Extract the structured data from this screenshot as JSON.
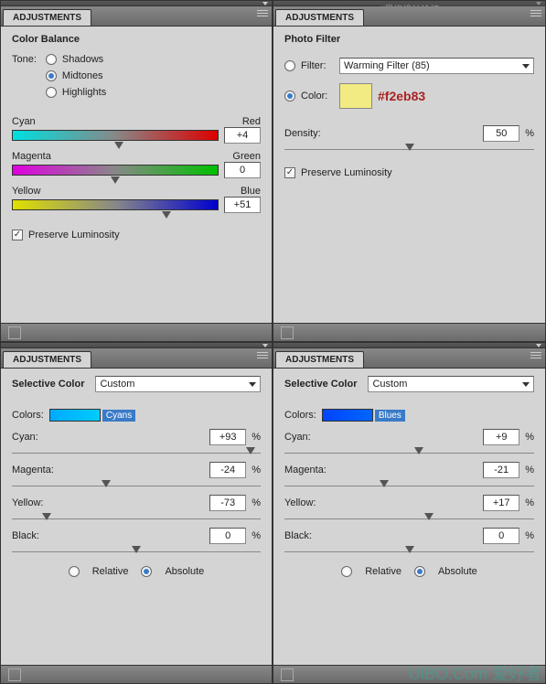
{
  "watermark_top": "思缘设计论坛 WWW.MISSYUAN.COM",
  "watermark_bottom": "UiBO.Com 爱好者",
  "panels": {
    "cb": {
      "tab": "ADJUSTMENTS",
      "title": "Color Balance",
      "tone_label": "Tone:",
      "shadows": "Shadows",
      "midtones": "Midtones",
      "highlights": "Highlights",
      "cyan": "Cyan",
      "red": "Red",
      "val1": "+4",
      "magenta": "Magenta",
      "green": "Green",
      "val2": "0",
      "yellow": "Yellow",
      "blue": "Blue",
      "val3": "+51",
      "preserve": "Preserve Luminosity"
    },
    "pf": {
      "tab": "ADJUSTMENTS",
      "title": "Photo Filter",
      "filter_label": "Filter:",
      "filter_value": "Warming Filter (85)",
      "color_label": "Color:",
      "hex": "#f2eb83",
      "density_label": "Density:",
      "density_value": "50",
      "pct": "%",
      "preserve": "Preserve Luminosity"
    },
    "sc1": {
      "tab": "ADJUSTMENTS",
      "title": "Selective Color",
      "preset": "Custom",
      "colors_label": "Colors:",
      "colors_value": "Cyans",
      "cyan_l": "Cyan:",
      "cyan_v": "+93",
      "mag_l": "Magenta:",
      "mag_v": "-24",
      "yel_l": "Yellow:",
      "yel_v": "-73",
      "blk_l": "Black:",
      "blk_v": "0",
      "pct": "%",
      "relative": "Relative",
      "absolute": "Absolute"
    },
    "sc2": {
      "tab": "ADJUSTMENTS",
      "title": "Selective Color",
      "preset": "Custom",
      "colors_label": "Colors:",
      "colors_value": "Blues",
      "cyan_l": "Cyan:",
      "cyan_v": "+9",
      "mag_l": "Magenta:",
      "mag_v": "-21",
      "yel_l": "Yellow:",
      "yel_v": "+17",
      "blk_l": "Black:",
      "blk_v": "0",
      "pct": "%",
      "relative": "Relative",
      "absolute": "Absolute"
    }
  }
}
